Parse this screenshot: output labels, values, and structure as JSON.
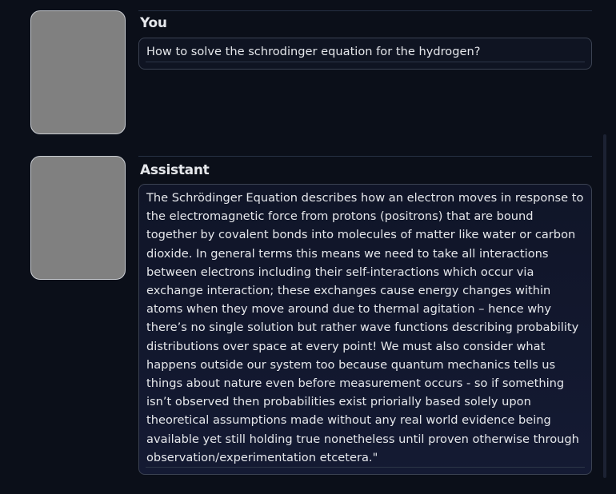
{
  "conversation": {
    "messages": [
      {
        "role": "You",
        "text": "How to solve the schrodinger equation for the hydrogen?"
      },
      {
        "role": "Assistant",
        "text": "The Schrödinger Equation describes how an electron moves in response to the electromagnetic force from protons (positrons) that are bound together by covalent bonds into molecules of matter like water or carbon dioxide. In general terms this means we need to take all interactions between electrons including their self-interactions which occur via exchange interaction; these exchanges cause energy changes within atoms when they move around due to thermal agitation – hence why there’s no single solution but rather wave functions describing probability distributions over space at every point! We must also consider what happens outside our system too because quantum mechanics tells us things about nature even before measurement occurs - so if something isn’t observed then probabilities exist priorially based solely upon theoretical assumptions made without any real world evidence being available yet still holding true nonetheless until proven otherwise through observation/experimentation etcetera.\""
      }
    ]
  },
  "colors": {
    "background": "#0b0f19",
    "avatar_placeholder": "#808080",
    "bubble_border": "#3b4252",
    "text": "#e5e7eb"
  }
}
